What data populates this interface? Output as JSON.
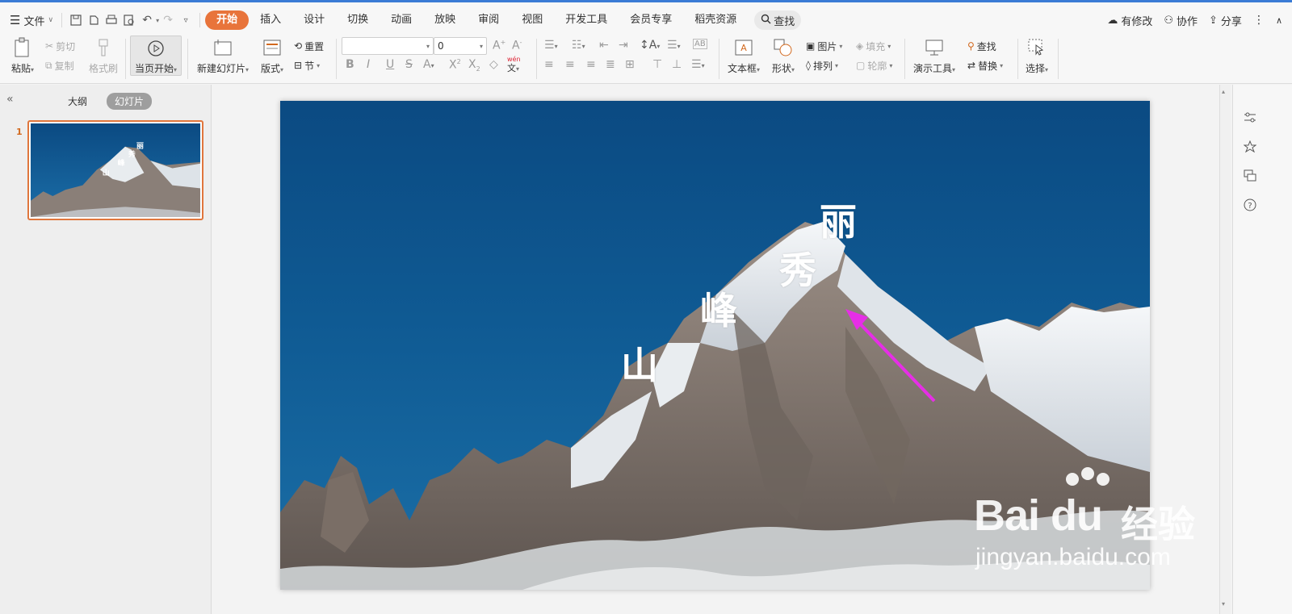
{
  "menubar": {
    "file_label": "文件",
    "tabs": [
      {
        "label": "开始",
        "active": true
      },
      {
        "label": "插入"
      },
      {
        "label": "设计"
      },
      {
        "label": "切换"
      },
      {
        "label": "动画"
      },
      {
        "label": "放映"
      },
      {
        "label": "审阅"
      },
      {
        "label": "视图"
      },
      {
        "label": "开发工具"
      },
      {
        "label": "会员专享"
      },
      {
        "label": "稻壳资源"
      }
    ],
    "search_label": "查找",
    "right": {
      "modified": "有修改",
      "collab": "协作",
      "share": "分享"
    },
    "accent_color": "#e8743b"
  },
  "ribbon": {
    "paste": "粘贴",
    "cut": "剪切",
    "copy": "复制",
    "format_painter": "格式刷",
    "play_from_current": "当页开始",
    "new_slide": "新建幻灯片",
    "layout": "版式",
    "reset": "重置",
    "section": "节",
    "font_size_value": "0",
    "textbox": "文本框",
    "shape": "形状",
    "picture": "图片",
    "fill": "填充",
    "arrange": "排列",
    "outline": "轮廓",
    "present_tools": "演示工具",
    "find": "查找",
    "replace": "替换",
    "select": "选择",
    "phonetic": "wén"
  },
  "leftpane": {
    "tabs": [
      {
        "label": "大纲"
      },
      {
        "label": "幻灯片",
        "active": true
      }
    ],
    "slide_number": "1"
  },
  "slide": {
    "characters": [
      "山",
      "峰",
      "秀",
      "丽"
    ]
  },
  "watermark": {
    "brand": "Bai du",
    "cn": "经验",
    "url": "jingyan.baidu.com"
  }
}
